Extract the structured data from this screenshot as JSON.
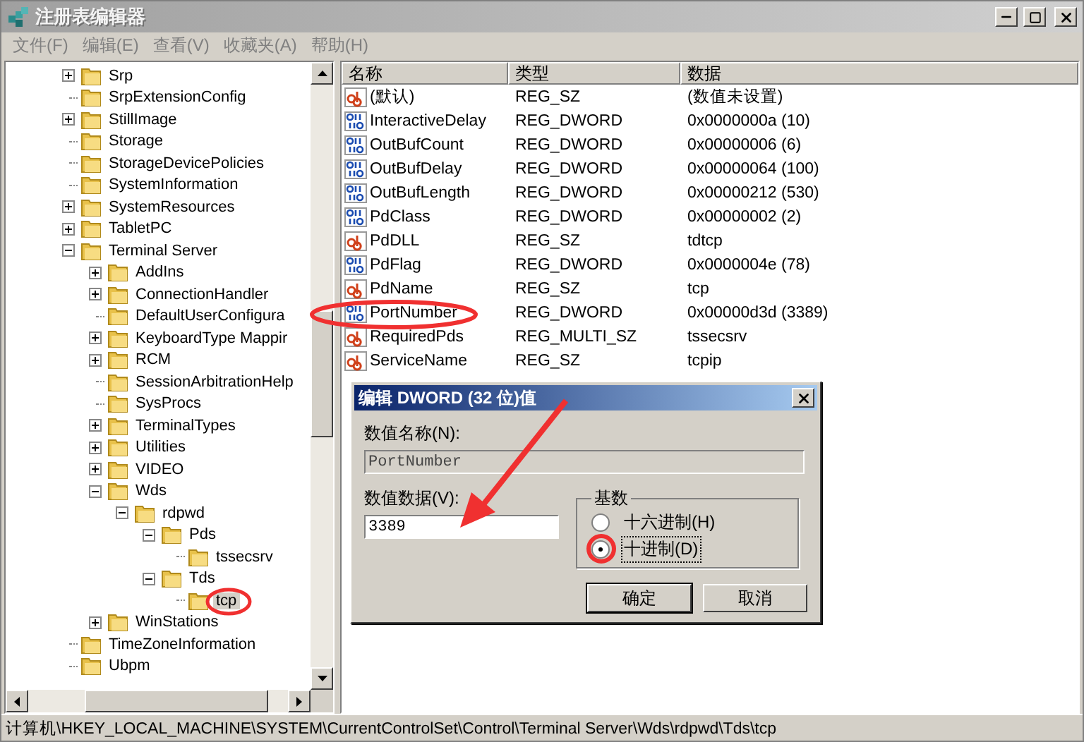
{
  "window": {
    "title": "注册表编辑器"
  },
  "menu": [
    "文件(F)",
    "编辑(E)",
    "查看(V)",
    "收藏夹(A)",
    "帮助(H)"
  ],
  "tree": [
    {
      "label": "Srp",
      "expandable": true,
      "expanded": false,
      "selected": false
    },
    {
      "label": "SrpExtensionConfig",
      "expandable": false,
      "selected": false
    },
    {
      "label": "StillImage",
      "expandable": true,
      "expanded": false,
      "selected": false
    },
    {
      "label": "Storage",
      "expandable": false,
      "selected": false
    },
    {
      "label": "StorageDevicePolicies",
      "expandable": false,
      "selected": false
    },
    {
      "label": "SystemInformation",
      "expandable": false,
      "selected": false
    },
    {
      "label": "SystemResources",
      "expandable": true,
      "expanded": false,
      "selected": false
    },
    {
      "label": "TabletPC",
      "expandable": true,
      "expanded": false,
      "selected": false
    },
    {
      "label": "Terminal Server",
      "expandable": true,
      "expanded": true,
      "selected": false,
      "children": [
        {
          "label": "AddIns",
          "expandable": true,
          "expanded": false,
          "selected": false
        },
        {
          "label": "ConnectionHandler",
          "expandable": true,
          "expanded": false,
          "selected": false
        },
        {
          "label": "DefaultUserConfigura",
          "expandable": false,
          "selected": false
        },
        {
          "label": "KeyboardType Mappir",
          "expandable": true,
          "expanded": false,
          "selected": false
        },
        {
          "label": "RCM",
          "expandable": true,
          "expanded": false,
          "selected": false
        },
        {
          "label": "SessionArbitrationHelp",
          "expandable": false,
          "selected": false
        },
        {
          "label": "SysProcs",
          "expandable": false,
          "selected": false
        },
        {
          "label": "TerminalTypes",
          "expandable": true,
          "expanded": false,
          "selected": false
        },
        {
          "label": "Utilities",
          "expandable": true,
          "expanded": false,
          "selected": false
        },
        {
          "label": "VIDEO",
          "expandable": true,
          "expanded": false,
          "selected": false
        },
        {
          "label": "Wds",
          "expandable": true,
          "expanded": true,
          "selected": false,
          "children": [
            {
              "label": "rdpwd",
              "expandable": true,
              "expanded": true,
              "selected": false,
              "children": [
                {
                  "label": "Pds",
                  "expandable": true,
                  "expanded": true,
                  "selected": false,
                  "children": [
                    {
                      "label": "tssecsrv",
                      "expandable": false,
                      "selected": false
                    }
                  ]
                },
                {
                  "label": "Tds",
                  "expandable": true,
                  "expanded": true,
                  "selected": false,
                  "children": [
                    {
                      "label": "tcp",
                      "expandable": false,
                      "selected": true
                    }
                  ]
                }
              ]
            }
          ]
        },
        {
          "label": "WinStations",
          "expandable": true,
          "expanded": false,
          "selected": false
        }
      ]
    },
    {
      "label": "TimeZoneInformation",
      "expandable": false,
      "selected": false
    },
    {
      "label": "Ubpm",
      "expandable": false,
      "selected": false
    }
  ],
  "values": {
    "columns": [
      "名称",
      "类型",
      "数据"
    ],
    "rows": [
      {
        "kind": "string",
        "name": "(默认)",
        "type": "REG_SZ",
        "data": "(数值未设置)"
      },
      {
        "kind": "binary",
        "name": "InteractiveDelay",
        "type": "REG_DWORD",
        "data": "0x0000000a (10)"
      },
      {
        "kind": "binary",
        "name": "OutBufCount",
        "type": "REG_DWORD",
        "data": "0x00000006 (6)"
      },
      {
        "kind": "binary",
        "name": "OutBufDelay",
        "type": "REG_DWORD",
        "data": "0x00000064 (100)"
      },
      {
        "kind": "binary",
        "name": "OutBufLength",
        "type": "REG_DWORD",
        "data": "0x00000212 (530)"
      },
      {
        "kind": "binary",
        "name": "PdClass",
        "type": "REG_DWORD",
        "data": "0x00000002 (2)"
      },
      {
        "kind": "string",
        "name": "PdDLL",
        "type": "REG_SZ",
        "data": "tdtcp"
      },
      {
        "kind": "binary",
        "name": "PdFlag",
        "type": "REG_DWORD",
        "data": "0x0000004e (78)"
      },
      {
        "kind": "string",
        "name": "PdName",
        "type": "REG_SZ",
        "data": "tcp"
      },
      {
        "kind": "binary",
        "name": "PortNumber",
        "type": "REG_DWORD",
        "data": "0x00000d3d (3389)"
      },
      {
        "kind": "string",
        "name": "RequiredPds",
        "type": "REG_MULTI_SZ",
        "data": "tssecsrv"
      },
      {
        "kind": "string",
        "name": "ServiceName",
        "type": "REG_SZ",
        "data": "tcpip"
      }
    ]
  },
  "dialog": {
    "title": "编辑 DWORD (32 位)值",
    "name_label": "数值名称(N):",
    "name_value": "PortNumber",
    "data_label": "数值数据(V):",
    "data_value": "3389",
    "base_label": "基数",
    "bases": [
      {
        "label": "十六进制(H)",
        "selected": false
      },
      {
        "label": "十进制(D)",
        "selected": true
      }
    ],
    "buttons": [
      "确定",
      "取消"
    ]
  },
  "status_bar": "计算机\\HKEY_LOCAL_MACHINE\\SYSTEM\\CurrentControlSet\\Control\\Terminal Server\\Wds\\rdpwd\\Tds\\tcp"
}
